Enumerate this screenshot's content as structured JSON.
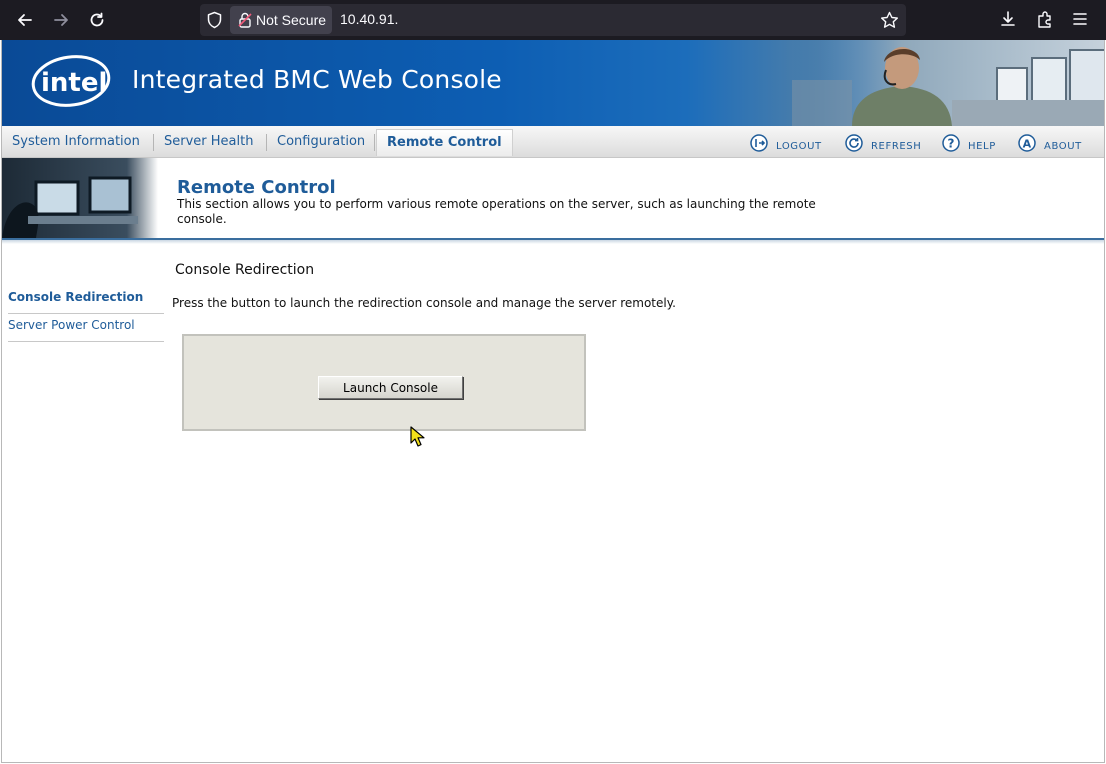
{
  "browser": {
    "security_label": "Not Secure",
    "url": "10.40.91."
  },
  "banner": {
    "logo_text": "intel",
    "title": "Integrated BMC Web Console"
  },
  "nav": {
    "tabs": [
      {
        "label": "System Information"
      },
      {
        "label": "Server Health"
      },
      {
        "label": "Configuration"
      },
      {
        "label": "Remote Control"
      }
    ],
    "active_tab": "Remote Control",
    "utilities": [
      {
        "label": "LOGOUT",
        "icon": "logout-icon"
      },
      {
        "label": "REFRESH",
        "icon": "refresh-icon"
      },
      {
        "label": "HELP",
        "icon": "help-icon"
      },
      {
        "label": "ABOUT",
        "icon": "about-icon"
      }
    ]
  },
  "section": {
    "title": "Remote Control",
    "description": "This section allows you to perform various remote operations on the server, such as launching the remote console."
  },
  "sidebar": {
    "items": [
      {
        "label": "Console Redirection",
        "active": true
      },
      {
        "label": "Server Power Control",
        "active": false
      }
    ]
  },
  "content": {
    "title": "Console Redirection",
    "description": "Press the button to launch the redirection console and manage the server remotely.",
    "launch_button": "Launch Console"
  },
  "colors": {
    "brand_blue": "#0d5eb3",
    "link_blue": "#1f5c99",
    "panel_bg": "#e5e4dc"
  }
}
